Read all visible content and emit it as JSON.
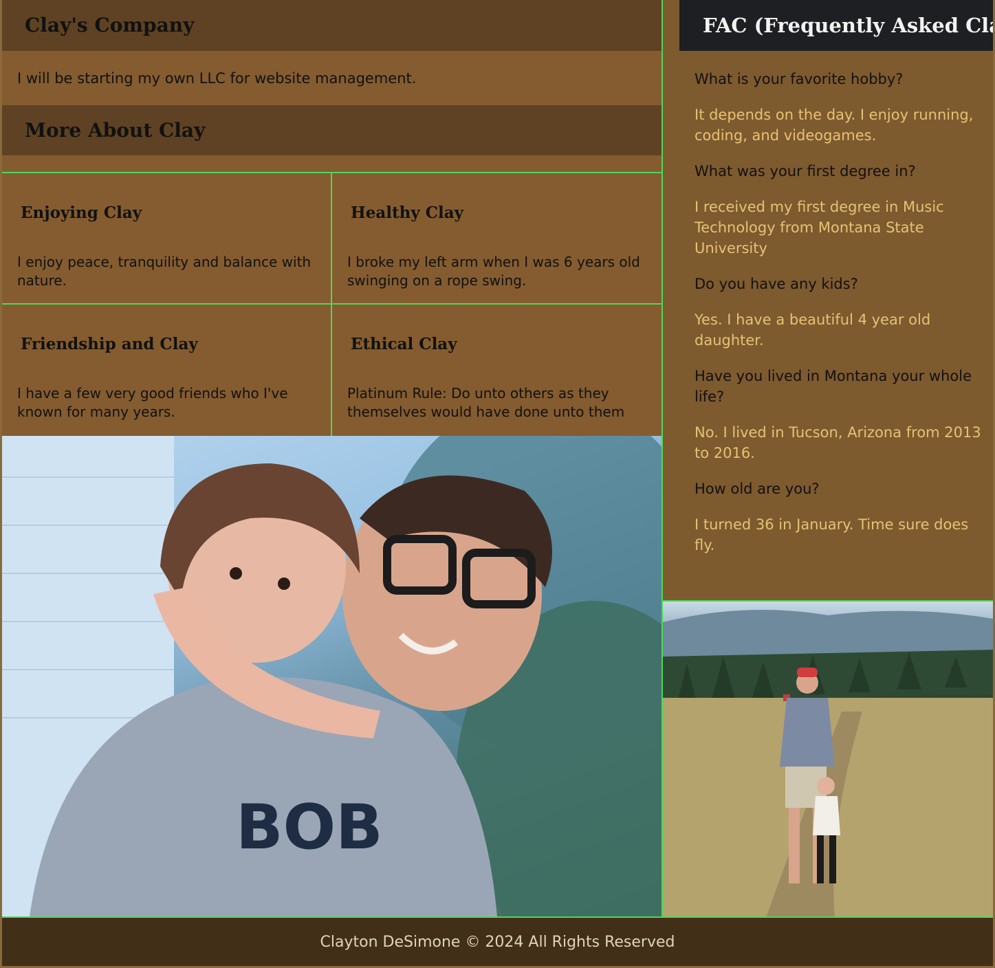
{
  "company": {
    "title": "Clay's Company",
    "text": "I will be starting my own LLC for website management."
  },
  "more": {
    "title": "More About Clay",
    "cells": [
      {
        "title": "Enjoying Clay",
        "text": "I enjoy peace, tranquility and balance with nature."
      },
      {
        "title": "Healthy Clay",
        "text": "I broke my left arm when I was 6 years old swinging on a rope swing."
      },
      {
        "title": "Friendship and Clay",
        "text": "I have a few very good friends who I've known for many years."
      },
      {
        "title": "Ethical Clay",
        "text": "Platinum Rule: Do unto others as they themselves would have done unto them"
      }
    ]
  },
  "fac": {
    "title": "FAC (Frequently Asked Clay)",
    "items": [
      {
        "q": "What is your favorite hobby?",
        "a": "It depends on the day. I enjoy running, coding, and videogames."
      },
      {
        "q": "What was your first degree in?",
        "a": "I received my first degree in Music Technology from Montana State University"
      },
      {
        "q": "Do you have any kids?",
        "a": "Yes. I have a beautiful 4 year old daughter."
      },
      {
        "q": "Have you lived in Montana your whole life?",
        "a": "No. I lived in Tucson, Arizona from 2013 to 2016."
      },
      {
        "q": "How old are you?",
        "a": "I turned 36 in January. Time sure does fly."
      }
    ]
  },
  "photos": {
    "main_shirt_text": "BOB"
  },
  "footer": {
    "text": "Clayton DeSimone © 2024 All Rights Reserved"
  }
}
